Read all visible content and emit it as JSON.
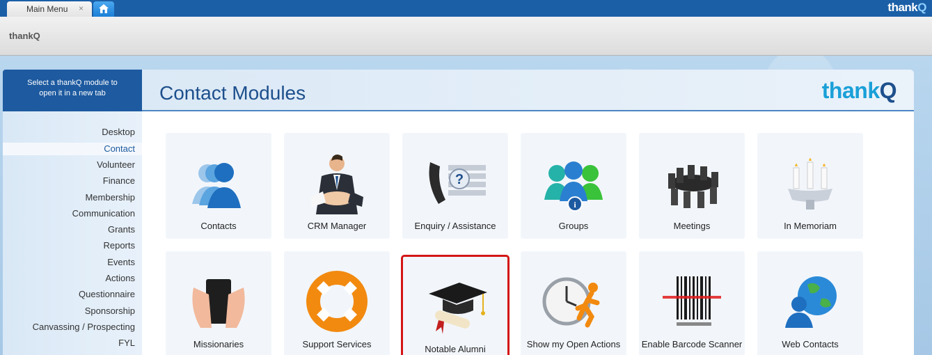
{
  "tabbar": {
    "tab_label": "Main Menu",
    "close_glyph": "×",
    "home_icon": "home-icon",
    "brand": "thank"
  },
  "header": {
    "title": "thankQ"
  },
  "sidebar": {
    "instructions": "Select a thankQ module to open it in a new tab",
    "items": [
      {
        "label": "Desktop"
      },
      {
        "label": "Contact"
      },
      {
        "label": "Volunteer"
      },
      {
        "label": "Finance"
      },
      {
        "label": "Membership"
      },
      {
        "label": "Communication"
      },
      {
        "label": "Grants"
      },
      {
        "label": "Reports"
      },
      {
        "label": "Events"
      },
      {
        "label": "Actions"
      },
      {
        "label": "Questionnaire"
      },
      {
        "label": "Sponsorship"
      },
      {
        "label": "Canvassing / Prospecting"
      },
      {
        "label": "FYL"
      }
    ],
    "active_item": "Contact"
  },
  "main": {
    "title": "Contact Modules",
    "logo_text": "thank",
    "logo_q": "Q",
    "modules": [
      {
        "label": "Contacts",
        "icon": "contacts-people-icon"
      },
      {
        "label": "CRM Manager",
        "icon": "handshake-icon"
      },
      {
        "label": "Enquiry / Assistance",
        "icon": "phone-question-icon"
      },
      {
        "label": "Groups",
        "icon": "group-info-icon"
      },
      {
        "label": "Meetings",
        "icon": "meeting-table-icon"
      },
      {
        "label": "In Memoriam",
        "icon": "candles-icon"
      },
      {
        "label": "Missionaries",
        "icon": "bible-hands-icon"
      },
      {
        "label": "Support Services",
        "icon": "lifebuoy-icon"
      },
      {
        "label": "Notable Alumni",
        "icon": "graduation-cap-icon"
      },
      {
        "label": "Show my Open Actions",
        "icon": "clock-runner-icon"
      },
      {
        "label": "Enable Barcode Scanner",
        "icon": "barcode-icon"
      },
      {
        "label": "Web Contacts",
        "icon": "globe-person-icon"
      }
    ],
    "selected_module": "Notable Alumni"
  },
  "colors": {
    "tabbar": "#1b5fa7",
    "accent": "#1d5aa0",
    "selection_outline": "#d41515"
  }
}
